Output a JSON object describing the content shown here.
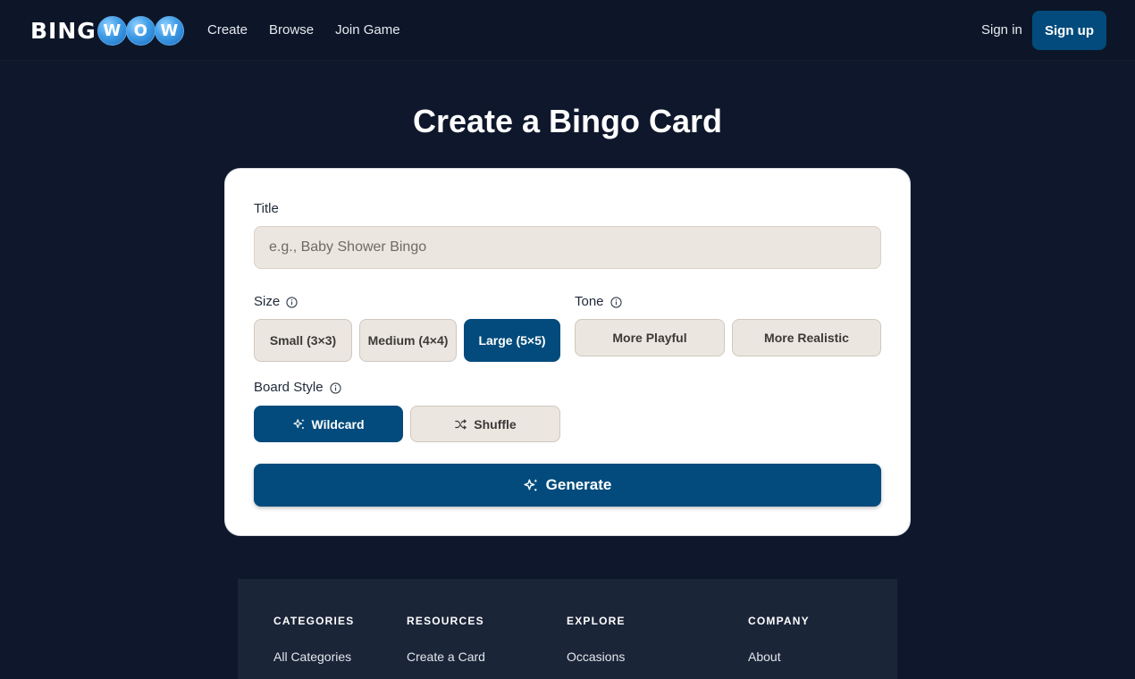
{
  "header": {
    "logo_prefix": "BING",
    "logo_balls": [
      "W",
      "O",
      "W"
    ],
    "nav": [
      "Create",
      "Browse",
      "Join Game"
    ],
    "sign_in": "Sign in",
    "sign_up": "Sign up"
  },
  "page_title": "Create a Bingo Card",
  "form": {
    "title_label": "Title",
    "title_placeholder": "e.g., Baby Shower Bingo",
    "title_value": "",
    "size_label": "Size",
    "size_options": [
      "Small (3×3)",
      "Medium (4×4)",
      "Large (5×5)"
    ],
    "size_selected": "Large (5×5)",
    "tone_label": "Tone",
    "tone_options": [
      "More Playful",
      "More Realistic"
    ],
    "board_style_label": "Board Style",
    "board_style_options": [
      "Wildcard",
      "Shuffle"
    ],
    "board_style_selected": "Wildcard",
    "generate_label": "Generate"
  },
  "footer": {
    "columns": [
      {
        "heading": "CATEGORIES",
        "links": [
          "All Categories"
        ]
      },
      {
        "heading": "RESOURCES",
        "links": [
          "Create a Card"
        ]
      },
      {
        "heading": "EXPLORE",
        "links": [
          "Occasions"
        ]
      },
      {
        "heading": "COMPANY",
        "links": [
          "About"
        ]
      }
    ]
  },
  "colors": {
    "background": "#0e172b",
    "primary": "#024b7c",
    "option_bg": "#ece6e0",
    "footer_bg": "#1b2538"
  }
}
